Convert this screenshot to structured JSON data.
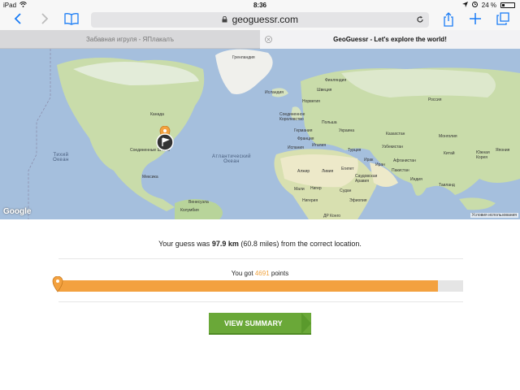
{
  "status_bar": {
    "device": "iPad",
    "time": "8:36",
    "battery": "24 %",
    "icons": [
      "wifi-icon",
      "location-icon",
      "alarm-icon",
      "battery-icon"
    ]
  },
  "toolbar": {
    "back_icon": "chevron-left-icon",
    "forward_icon": "chevron-right-icon",
    "bookmarks_icon": "book-icon",
    "url": "geoguessr.com",
    "share_icon": "share-icon",
    "new_tab_icon": "plus-icon",
    "tabs_icon": "tabs-icon"
  },
  "tabs": [
    {
      "label": "Забавная игруля - ЯПлакалъ",
      "active": false
    },
    {
      "label": "GeoGuessr - Let's explore the world!",
      "active": true
    }
  ],
  "map": {
    "labels": [
      "Гренландия",
      "Исландия",
      "Финляндия",
      "Швеция",
      "Норвегия",
      "Россия",
      "Канада",
      "Соединенное Королевство",
      "Польша",
      "Германия",
      "Украина",
      "Франция",
      "Италия",
      "Испания",
      "Казахстан",
      "Монголия",
      "Турция",
      "Узбекистан",
      "Китай",
      "Южная Корея",
      "Япония",
      "Соединенные Штаты",
      "Мексика",
      "Алжир",
      "Ливия",
      "Египет",
      "Ирак",
      "Иран",
      "Афганистан",
      "Пакистан",
      "Саудовская Аравия",
      "Индия",
      "Таиланд",
      "Мали",
      "Нигер",
      "Судан",
      "Нигерия",
      "Эфиопия",
      "Венесуэла",
      "Колумбия",
      "ДР Конго"
    ],
    "oceans": [
      "Тихий Океан",
      "Атлантический Океан"
    ],
    "logo": "Google",
    "terms": "Условия использования"
  },
  "result": {
    "prefix": "Your guess was ",
    "distance": "97.9 km",
    "suffix": " (60.8 miles) from the correct location."
  },
  "score": {
    "prefix": "You got ",
    "points": "4691",
    "suffix": " points",
    "fraction": 0.938
  },
  "button": {
    "label": "VIEW SUMMARY"
  },
  "colors": {
    "accent": "#1a7cf5",
    "progress": "#f3a13f",
    "button": "#6aa838",
    "ocean": "#a5bfdd",
    "land": "#c9dcaa"
  }
}
